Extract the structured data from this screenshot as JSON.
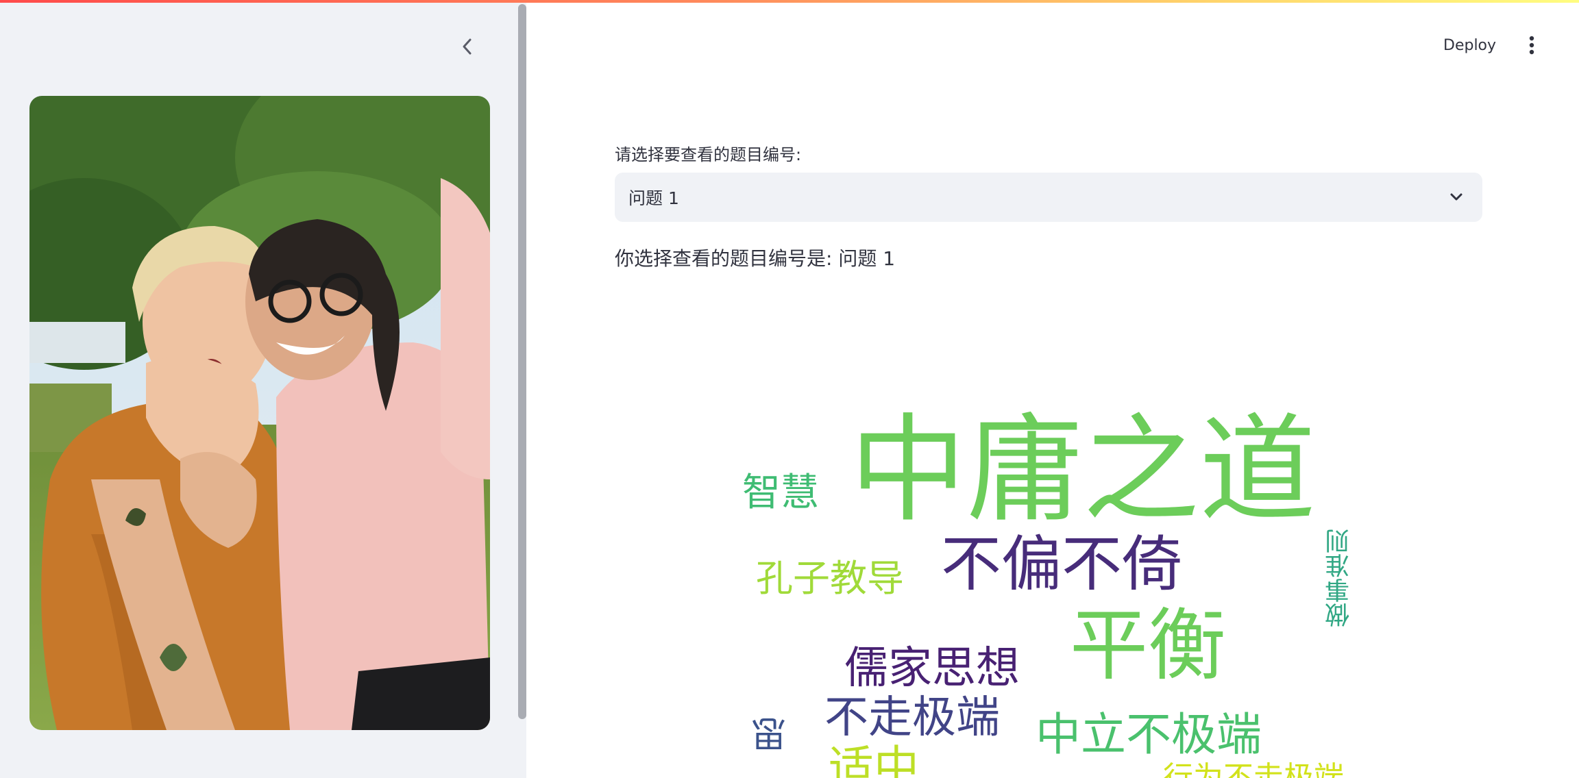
{
  "header": {
    "deploy_label": "Deploy"
  },
  "main": {
    "select_label": "请选择要查看的题目编号:",
    "selected_value": "问题 1",
    "result_text": "你选择查看的题目编号是: 问题 1"
  },
  "wordcloud": {
    "words": [
      {
        "text": "中庸之道",
        "color": "#6ccd5a"
      },
      {
        "text": "智慧",
        "color": "#3fbc73"
      },
      {
        "text": "孔子教导",
        "color": "#a0da39"
      },
      {
        "text": "不偏不倚",
        "color": "#472c7a"
      },
      {
        "text": "做事准则",
        "color": "#31a784"
      },
      {
        "text": "平衡",
        "color": "#6ccd5a"
      },
      {
        "text": "儒家思想",
        "color": "#482173"
      },
      {
        "text": "不走极端",
        "color": "#414487"
      },
      {
        "text": "中立不极端",
        "color": "#4ac16d"
      },
      {
        "text": "适中",
        "color": "#bddf26"
      },
      {
        "text": "行为不走极端",
        "color": "#d2e21b"
      },
      {
        "text": "思",
        "color": "#3b528b"
      }
    ]
  },
  "colors": {
    "sidebar_bg": "#f0f2f6",
    "text": "#31333f"
  },
  "icons": {
    "collapse": "chevron-left-icon",
    "menu": "vertical-dots-icon",
    "dropdown": "chevron-down-icon"
  }
}
